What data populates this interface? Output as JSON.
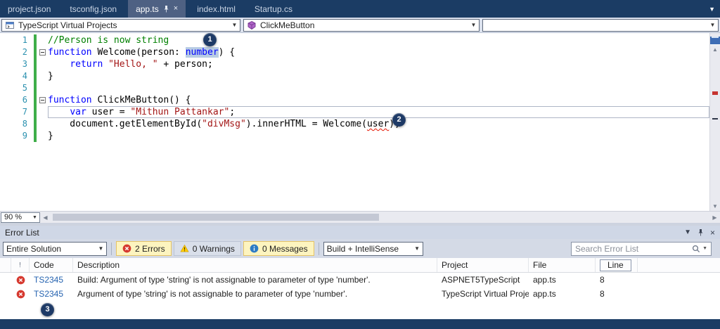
{
  "colors": {
    "titlebar_navy": "#1B3C64",
    "active_tab_bg": "#4E6183",
    "keyword_blue": "#0000FF",
    "string_red": "#A31515",
    "comment_green": "#008000",
    "line_number_blue": "#2B91AF",
    "change_bar_green": "#3FAE49",
    "error_red": "#D6392F",
    "selected_filter_bg": "#FDF4BF",
    "badge_navy": "#1E3A66"
  },
  "tabs": [
    {
      "label": "project.json",
      "active": false
    },
    {
      "label": "tsconfig.json",
      "active": false
    },
    {
      "label": "app.ts",
      "active": true
    },
    {
      "label": "index.html",
      "active": false
    },
    {
      "label": "Startup.cs",
      "active": false
    }
  ],
  "navbar": {
    "project_dropdown": "TypeScript Virtual Projects",
    "member_dropdown": "ClickMeButton"
  },
  "editor": {
    "zoom_level": "90 %",
    "lines": [
      {
        "num": "1",
        "tokens": [
          {
            "t": "//Person is now string",
            "c": "comment"
          }
        ]
      },
      {
        "num": "2",
        "fold": true,
        "tokens": [
          {
            "t": "function",
            "c": "kw"
          },
          {
            "t": " Welcome(person: ",
            "c": "plain"
          },
          {
            "t": "number",
            "c": "kw",
            "hl": true
          },
          {
            "t": ") {",
            "c": "plain"
          }
        ]
      },
      {
        "num": "3",
        "tokens": [
          {
            "t": "    ",
            "c": "plain"
          },
          {
            "t": "return",
            "c": "kw"
          },
          {
            "t": " ",
            "c": "plain"
          },
          {
            "t": "\"Hello, \"",
            "c": "str"
          },
          {
            "t": " + person;",
            "c": "plain"
          }
        ]
      },
      {
        "num": "4",
        "tokens": [
          {
            "t": "}",
            "c": "plain"
          }
        ]
      },
      {
        "num": "5",
        "tokens": []
      },
      {
        "num": "6",
        "fold": true,
        "tokens": [
          {
            "t": "function",
            "c": "kw"
          },
          {
            "t": " ClickMeButton() {",
            "c": "plain"
          }
        ]
      },
      {
        "num": "7",
        "caret": true,
        "tokens": [
          {
            "t": "    ",
            "c": "plain"
          },
          {
            "t": "var",
            "c": "kw"
          },
          {
            "t": " user = ",
            "c": "plain"
          },
          {
            "t": "\"Mithun Pattankar\"",
            "c": "str"
          },
          {
            "t": ";",
            "c": "plain"
          }
        ]
      },
      {
        "num": "8",
        "tokens": [
          {
            "t": "    document.getElementById(",
            "c": "plain"
          },
          {
            "t": "\"divMsg\"",
            "c": "str"
          },
          {
            "t": ").innerHTML = Welcome(",
            "c": "plain"
          },
          {
            "t": "user",
            "c": "plain",
            "sq": true
          },
          {
            "t": ");",
            "c": "plain"
          }
        ]
      },
      {
        "num": "9",
        "tokens": [
          {
            "t": "}",
            "c": "plain"
          }
        ]
      }
    ]
  },
  "badges": {
    "one": "1",
    "two": "2",
    "three": "3"
  },
  "error_list": {
    "title": "Error List",
    "scope_dropdown": "Entire Solution",
    "errors_label": "2 Errors",
    "warnings_label": "0 Warnings",
    "messages_label": "0 Messages",
    "source_dropdown": "Build + IntelliSense",
    "search_placeholder": "Search Error List",
    "columns": [
      "Code",
      "Description",
      "Project",
      "File",
      "Line"
    ],
    "rows": [
      {
        "code": "TS2345",
        "description": "Build: Argument of type 'string' is not assignable to parameter of type 'number'.",
        "project": "ASPNET5TypeScript",
        "file": "app.ts",
        "line": "8"
      },
      {
        "code": "TS2345",
        "description": "Argument of type 'string' is not assignable to parameter of type 'number'.",
        "project": "TypeScript Virtual Projects",
        "file": "app.ts",
        "line": "8"
      }
    ]
  }
}
